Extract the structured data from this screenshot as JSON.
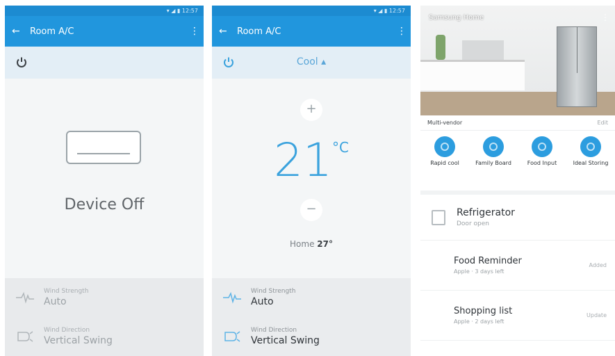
{
  "screen1": {
    "status": "▾ ◢ ▮ 12:57",
    "title": "Room A/C",
    "back_icon": "arrow-left-icon",
    "device_state": "Device Off",
    "settings": [
      {
        "label": "Wind Strength",
        "value": "Auto",
        "icon": "wind-icon"
      },
      {
        "label": "Wind Direction",
        "value": "Vertical Swing",
        "icon": "swing-icon"
      }
    ]
  },
  "screen2": {
    "status": "▾ ◢ ▮ 12:57",
    "title": "Room A/C",
    "mode": "Cool",
    "temperature": "21",
    "temperature_unit": "°C",
    "increase": "+",
    "decrease": "−",
    "home_label": "Home",
    "home_temp": "27°",
    "settings": [
      {
        "label": "Wind Strength",
        "value": "Auto",
        "icon": "wind-icon"
      },
      {
        "label": "Wind Direction",
        "value": "Vertical Swing",
        "icon": "swing-icon"
      }
    ]
  },
  "screen3": {
    "hero_title": "Samsung Home",
    "subbar_left": "Multi-vendor",
    "subbar_right": "Edit",
    "quick_actions": [
      {
        "label": "Rapid cool"
      },
      {
        "label": "Family Board"
      },
      {
        "label": "Food Input"
      },
      {
        "label": "Ideal Storing"
      }
    ],
    "device": {
      "title": "Refrigerator",
      "subtitle": "Door open"
    },
    "items": [
      {
        "title": "Food Reminder",
        "subtitle": "Apple · 3 days left",
        "right": "Added"
      },
      {
        "title": "Shopping list",
        "subtitle": "Apple · 2 days left",
        "right": "Update"
      }
    ]
  }
}
